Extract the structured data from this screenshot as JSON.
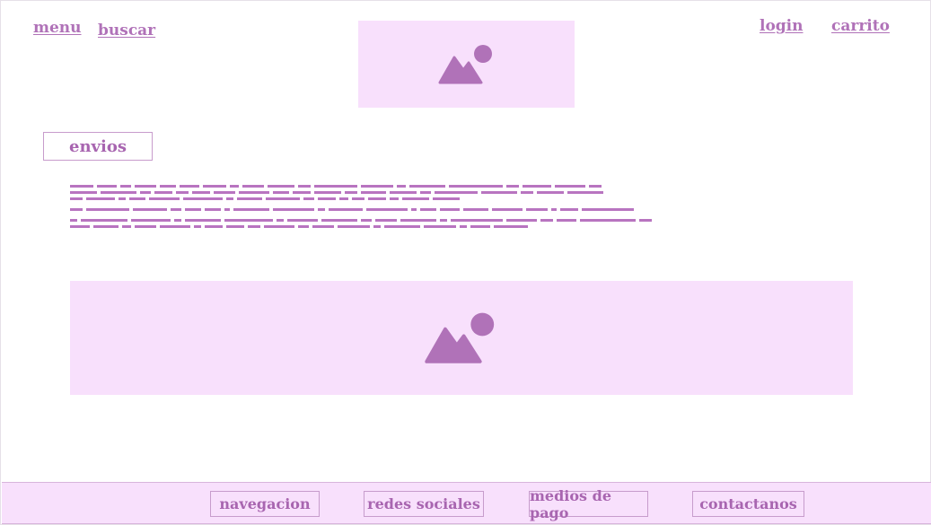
{
  "header": {
    "menu_label": "menu",
    "search_label": "buscar",
    "login_label": "login",
    "cart_label": "carrito",
    "logo_icon": "image-placeholder-icon"
  },
  "main": {
    "section_label": "envios",
    "hero_icon": "image-placeholder-icon"
  },
  "footer": {
    "items": [
      "navegacion",
      "redes sociales",
      "medios de pago",
      "contactanos"
    ]
  },
  "colors": {
    "accent": "#b072b8",
    "placeholder_bg": "#f8e0fc"
  }
}
